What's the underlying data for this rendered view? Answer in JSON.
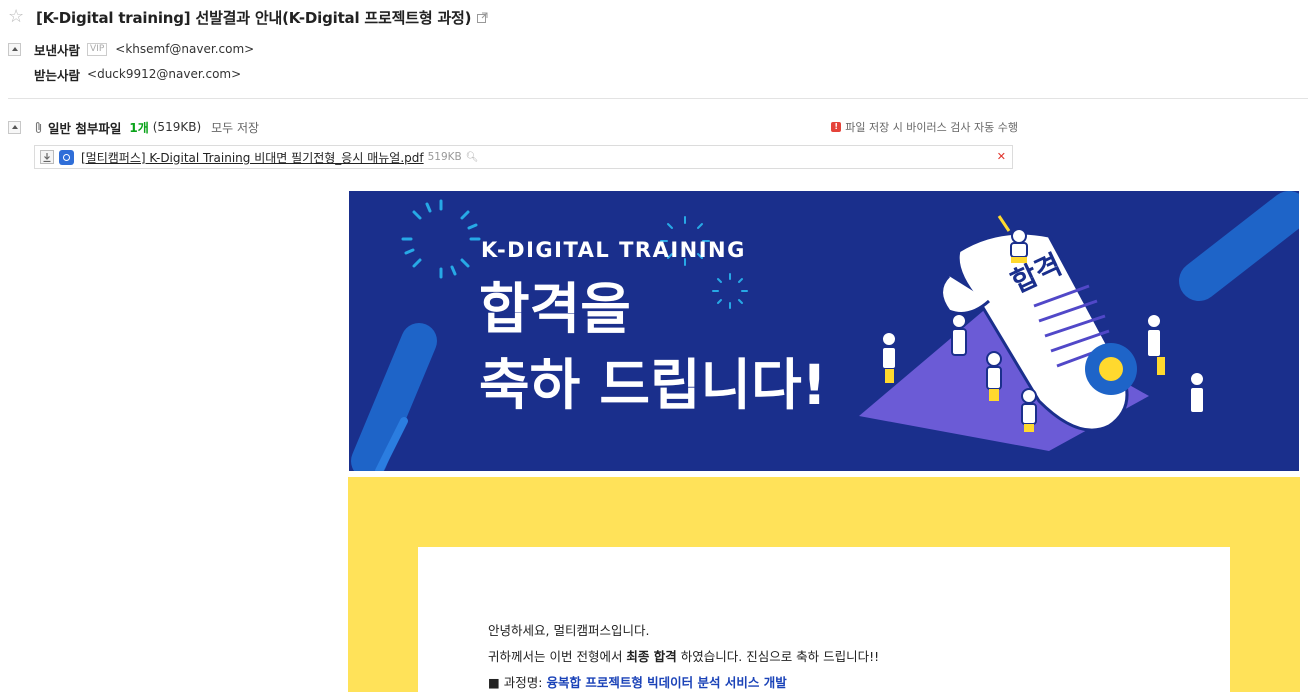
{
  "mail": {
    "subject": "[K-Digital training] 선발결과 안내(K-Digital 프로젝트형 과정)",
    "sender_label": "보낸사람",
    "sender_badge": "VIP",
    "sender_addr": "<khsemf@naver.com>",
    "recipient_label": "받는사람",
    "recipient_addr": "<duck9912@naver.com>"
  },
  "attachments": {
    "title": "일반 첨부파일",
    "count": "1개",
    "total_size": "(519KB)",
    "save_all": "모두 저장",
    "scan_notice": "파일 저장 시 바이러스 검사 자동 수행",
    "file_name": "[멀티캠퍼스] K-Digital Training 비대면 필기전형_응시 매뉴얼.pdf",
    "file_size": "519KB"
  },
  "banner": {
    "brand": "K-DIGITAL TRAINING",
    "headline_line1": "합격을",
    "headline_line2": "축하 드립니다!",
    "scroll_text": "합격",
    "colors": {
      "background": "#1a2f8c",
      "accent_blue": "#1e64c8",
      "purple": "#6b5bd6"
    }
  },
  "body": {
    "greeting": "안녕하세요, 멀티캠퍼스입니다.",
    "line2_before": "귀하께서는 이번 전형에서 ",
    "line2_bold": "최종 합격",
    "line2_after": " 하였습니다. 진심으로 축하 드립니다!!",
    "course_label": "■ 과정명: ",
    "course_name": "융복합 프로젝트형 빅데이터 분석 서비스 개발"
  },
  "colors": {
    "yellow_frame": "#ffe259",
    "course_text": "#1b43b8",
    "count_green": "#09a319"
  }
}
